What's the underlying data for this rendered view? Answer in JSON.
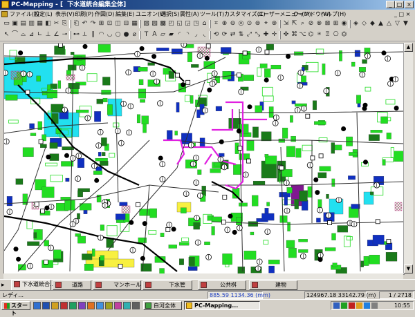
{
  "window": {
    "app_name": "PC-Mapping - [",
    "document_title": "下水道統合編集全体]"
  },
  "menu": [
    {
      "id": "file",
      "label": "ファイル(F)"
    },
    {
      "id": "settings",
      "label": "設定(L)"
    },
    {
      "id": "view",
      "label": "表示(V)"
    },
    {
      "id": "print",
      "label": "印刷(P)"
    },
    {
      "id": "draw",
      "label": "作図(D)"
    },
    {
      "id": "edit",
      "label": "編集(E)"
    },
    {
      "id": "union",
      "label": "ユニオン(U)"
    },
    {
      "id": "select",
      "label": "選択(S)"
    },
    {
      "id": "attribute",
      "label": "属性(A)"
    },
    {
      "id": "tool",
      "label": "ツール(T)"
    },
    {
      "id": "customize",
      "label": "カスタマイズ(C)"
    },
    {
      "id": "user-menu",
      "label": "ユーザーメニュー(M)"
    },
    {
      "id": "window",
      "label": "ウィンドウ(W)"
    },
    {
      "id": "help",
      "label": "ヘルプ(H)"
    }
  ],
  "tabs": [
    {
      "label": "下水道統合...",
      "active": true
    },
    {
      "label": "道路",
      "active": false
    },
    {
      "label": "マンホール",
      "active": false
    },
    {
      "label": "下水管",
      "active": false
    },
    {
      "label": "公共桝",
      "active": false
    },
    {
      "label": "建物",
      "active": false
    }
  ],
  "status": {
    "ready": "レディ...",
    "cursor_coords": "885.59 1134.36 (mm)",
    "map_coords": "124967.18 33142.79 (m)",
    "scale": "1 / 2718"
  },
  "taskbar": {
    "start": "スタート",
    "tasks": [
      {
        "label": "白河全体",
        "active": false
      },
      {
        "label": "PC-Mapping...",
        "active": true
      }
    ],
    "clock": "10:55"
  },
  "colors": {
    "title_bar": "#0a246a",
    "building_green": "#22dd22",
    "building_dark_green": "#1a7a1a",
    "water_cyan": "#22e0f0",
    "public_blue": "#1030c0",
    "facility_yellow": "#f8f040",
    "sewer_magenta": "#e020e0",
    "purple_building": "#801890"
  }
}
